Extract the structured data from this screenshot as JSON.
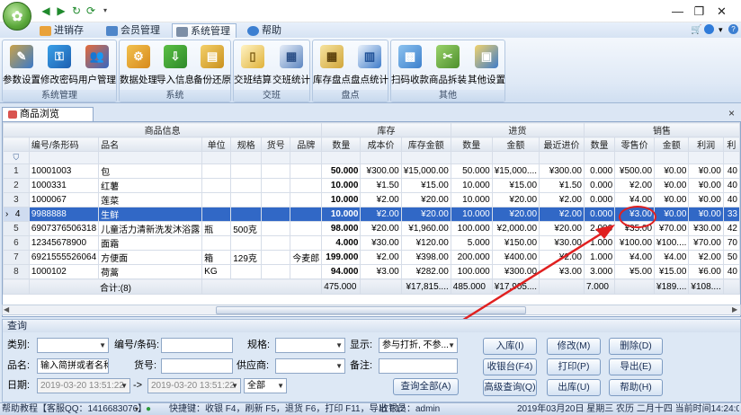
{
  "app": {
    "orb_icon": "app-logo-icon",
    "quick_access": [
      "back-icon",
      "forward-icon",
      "refresh-icon",
      "sync-icon",
      "dropdown-icon"
    ],
    "window_controls": [
      "—",
      "❐",
      "✕"
    ]
  },
  "menu": {
    "tabs": [
      {
        "label": "进销存",
        "icon": "home-icon",
        "active": false
      },
      {
        "label": "会员管理",
        "icon": "members-icon",
        "active": false
      },
      {
        "label": "系统管理",
        "icon": "tools-icon",
        "active": true
      },
      {
        "label": "帮助",
        "icon": "help-icon",
        "active": false
      }
    ]
  },
  "ribbon": {
    "groups": [
      {
        "label": "系统管理",
        "buttons": [
          "参数设置",
          "修改密码",
          "用户管理"
        ]
      },
      {
        "label": "系统",
        "buttons": [
          "数据处理",
          "导入信息",
          "备份还原"
        ]
      },
      {
        "label": "交班",
        "buttons": [
          "交班结算",
          "交班统计"
        ]
      },
      {
        "label": "盘点",
        "buttons": [
          "库存盘点",
          "盘点统计"
        ]
      },
      {
        "label": "其他",
        "buttons": [
          "扫码收款",
          "商品拆装",
          "其他设置"
        ]
      }
    ]
  },
  "document_tab": {
    "label": "商品浏览",
    "close": "×"
  },
  "grid": {
    "group_headers": [
      "商品信息",
      "库存",
      "进货",
      "销售"
    ],
    "columns": [
      "编号/条形码",
      "品名",
      "单位",
      "规格",
      "货号",
      "品牌",
      "数量",
      "成本价",
      "库存金额",
      "数量",
      "金额",
      "最近进价",
      "数量",
      "零售价",
      "金额",
      "利润",
      "利"
    ],
    "filter_icon": "filter-icon",
    "rows": [
      {
        "n": "1",
        "cells": [
          "10001003",
          "包",
          "",
          "",
          "",
          "",
          "50.000",
          "¥300.00",
          "¥15,000.00",
          "50.000",
          "¥15,000....",
          "¥300.00",
          "0.000",
          "¥500.00",
          "¥0.00",
          "¥0.00",
          "40"
        ]
      },
      {
        "n": "2",
        "cells": [
          "1000331",
          "红薯",
          "",
          "",
          "",
          "",
          "10.000",
          "¥1.50",
          "¥15.00",
          "10.000",
          "¥15.00",
          "¥1.50",
          "0.000",
          "¥2.00",
          "¥0.00",
          "¥0.00",
          "40"
        ]
      },
      {
        "n": "3",
        "cells": [
          "1000067",
          "莲菜",
          "",
          "",
          "",
          "",
          "10.000",
          "¥2.00",
          "¥20.00",
          "10.000",
          "¥20.00",
          "¥2.00",
          "0.000",
          "¥4.00",
          "¥0.00",
          "¥0.00",
          "40"
        ]
      },
      {
        "n": "4",
        "cells": [
          "9988888",
          "生鲜",
          "",
          "",
          "",
          "",
          "10.000",
          "¥2.00",
          "¥20.00",
          "10.000",
          "¥20.00",
          "¥2.00",
          "0.000",
          "¥3.00",
          "¥0.00",
          "¥0.00",
          "33"
        ],
        "selected": true
      },
      {
        "n": "5",
        "cells": [
          "6907376506318",
          "儿童活力清新洗发沐浴露",
          "瓶",
          "500克",
          "",
          "",
          "98.000",
          "¥20.00",
          "¥1,960.00",
          "100.000",
          "¥2,000.00",
          "¥20.00",
          "2.000",
          "¥35.00",
          "¥70.00",
          "¥30.00",
          "42"
        ]
      },
      {
        "n": "6",
        "cells": [
          "12345678900",
          "面霜",
          "",
          "",
          "",
          "",
          "4.000",
          "¥30.00",
          "¥120.00",
          "5.000",
          "¥150.00",
          "¥30.00",
          "1.000",
          "¥100.00",
          "¥100....",
          "¥70.00",
          "70"
        ]
      },
      {
        "n": "7",
        "cells": [
          "6921555526064",
          "方便面",
          "箱",
          "129克",
          "",
          "今麦郎",
          "199.000",
          "¥2.00",
          "¥398.00",
          "200.000",
          "¥400.00",
          "¥2.00",
          "1.000",
          "¥4.00",
          "¥4.00",
          "¥2.00",
          "50"
        ]
      },
      {
        "n": "8",
        "cells": [
          "1000102",
          "荷蒿",
          "KG",
          "",
          "",
          "",
          "94.000",
          "¥3.00",
          "¥282.00",
          "100.000",
          "¥300.00",
          "¥3.00",
          "3.000",
          "¥5.00",
          "¥15.00",
          "¥6.00",
          "40"
        ]
      }
    ],
    "totals": {
      "label": "合计:(8)",
      "stock_qty": "475.000",
      "stock_amt": "¥17,815....",
      "in_qty": "485.000",
      "in_amt": "¥17,905....",
      "sale_qty": "7.000",
      "sale_amt": "¥189....",
      "profit": "¥108...."
    },
    "selected_marker": "›"
  },
  "query": {
    "title": "查询",
    "category_label": "类别:",
    "code_label": "编号/条码:",
    "spec_label": "规格:",
    "display_label": "显示:",
    "display_value": "参与打折, 不参...",
    "name_label": "品名:",
    "name_value": "输入简拼或者名称",
    "item_no_label": "货号:",
    "supplier_label": "供应商:",
    "note_label": "备注:",
    "date_label": "日期:",
    "date_from": "2019-03-20 13:51:22",
    "date_arrow": "->",
    "date_to": "2019-03-20 13:51:22",
    "period_value": "全部",
    "query_all_button": "查询全部(A)",
    "buttons": [
      "入库(I)",
      "修改(M)",
      "删除(D)",
      "收银台(F4)",
      "打印(P)",
      "导出(E)",
      "高级查询(Q)",
      "出库(U)",
      "帮助(H)"
    ]
  },
  "status": {
    "tutorial": "帮助教程【客服QQ：1416683076】",
    "shortcuts": "快捷键：收银 F4，刷新 F5，退货 F6，打印 F11，导出 F12",
    "cashier": "收银员：admin",
    "datetime": "2019年03月20日 星期三 农历 二月十四 当前时间14:24:02"
  },
  "colors": {
    "selected_row": "#3168c6",
    "annotation": "#e02020",
    "ribbon_bg": "#dfe9f6"
  }
}
